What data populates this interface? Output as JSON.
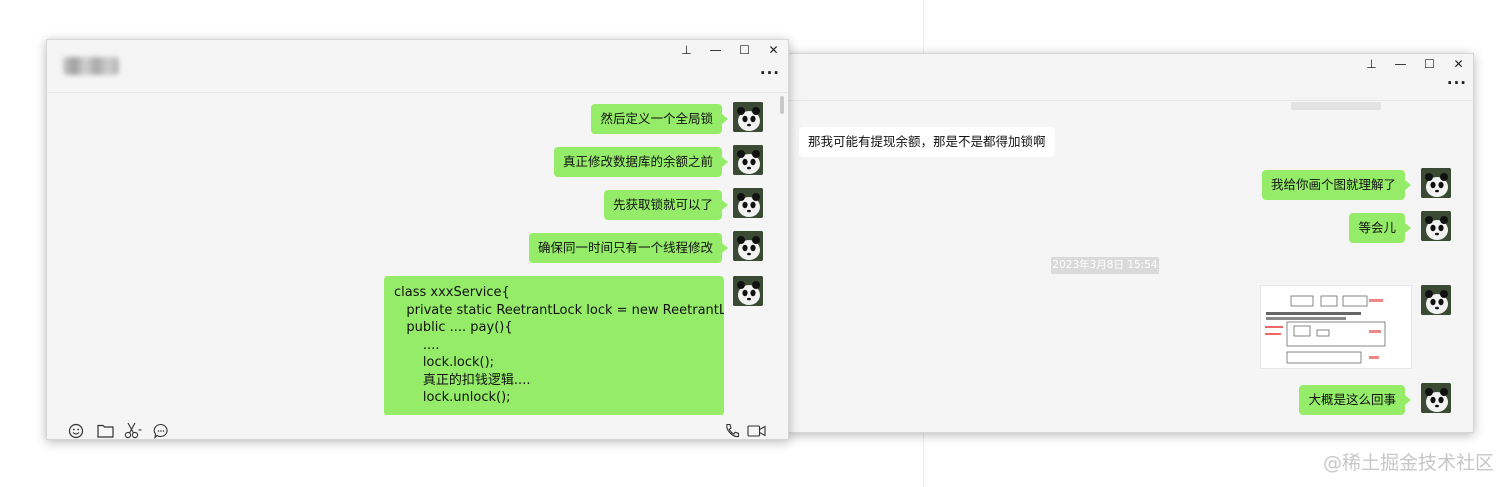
{
  "left_chat": {
    "messages": [
      "然后定义一个全局锁",
      "真正修改数据库的余额之前",
      "先获取锁就可以了",
      "确保同一时间只有一个线程修改"
    ],
    "code_lines": [
      "class xxxService{",
      "   private static ReetrantLock lock = new ReetrantLock();",
      "",
      "   public .... pay(){",
      "       ....",
      "       lock.lock();",
      "       真正的扣钱逻辑....",
      "       lock.unlock();"
    ]
  },
  "right_chat": {
    "incoming_message": "那我可能有提现余额，那是不是都得加锁啊",
    "messages": [
      "我给你画个图就理解了",
      "等会儿"
    ],
    "timestamp": "2023年3月8日 15:54",
    "last_message": "大概是这么回事"
  },
  "window_controls": {
    "pin": "⊥",
    "minimize": "—",
    "maximize": "☐",
    "close": "✕",
    "more": "···"
  },
  "watermark": "@稀土掘金技术社区",
  "colors": {
    "bubble_mine": "#95ec69",
    "bubble_theirs": "#ffffff",
    "window_bg": "#f5f5f5"
  }
}
